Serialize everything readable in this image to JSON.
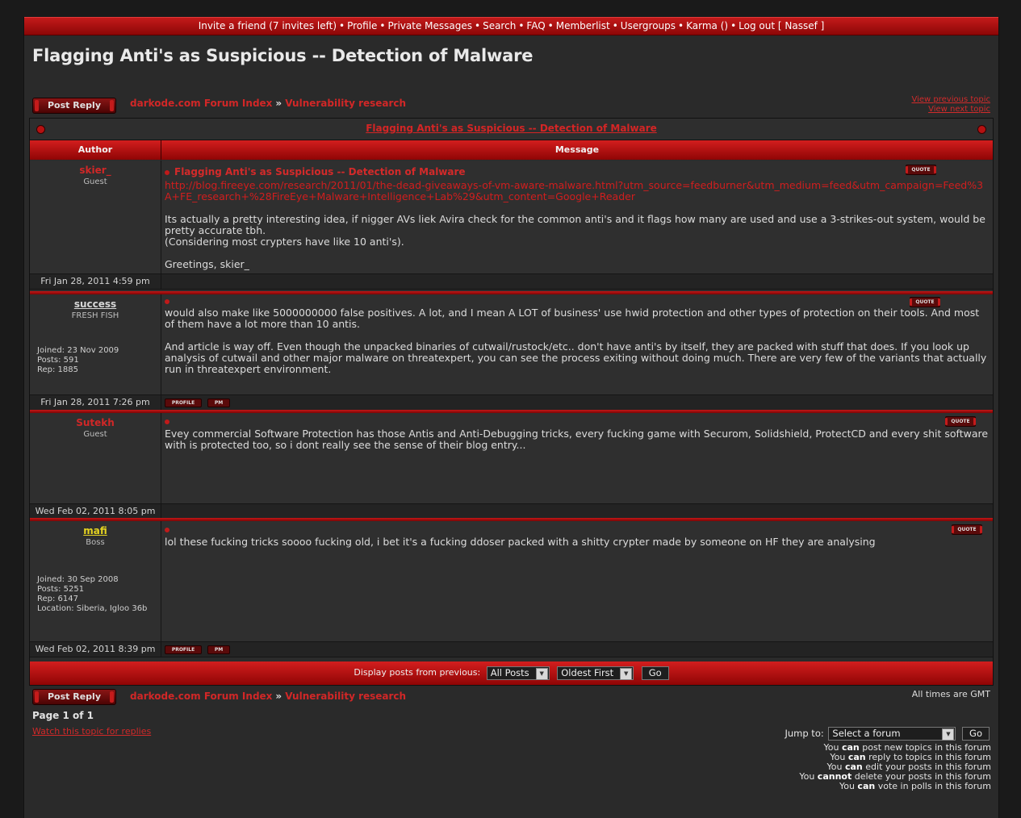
{
  "topnav": {
    "items": [
      "Invite a friend (7 invites left)",
      "Profile",
      "Private Messages",
      "Search",
      "FAQ",
      "Memberlist",
      "Usergroups",
      "Karma ()",
      "Log out [ Nassef ]"
    ],
    "separator": "•"
  },
  "page_title": "Flagging Anti's as Suspicious -- Detection of Malware",
  "post_reply_label": "Post Reply",
  "breadcrumb": {
    "home": "darkode.com Forum Index",
    "sep": "»",
    "forum": "Vulnerability research"
  },
  "prev_topic": "View previous topic",
  "next_topic": "View next topic",
  "topic_header": "Flagging Anti's as Suspicious -- Detection of Malware",
  "columns": {
    "author": "Author",
    "message": "Message"
  },
  "buttons": {
    "quote": "QUOTE",
    "profile": "PROFILE",
    "pm": "PM"
  },
  "posts": [
    {
      "author": "skier_",
      "rank": "Guest",
      "joined": "",
      "posts": "",
      "rep": "",
      "location": "",
      "subject": "Flagging Anti's as Suspicious -- Detection of Malware",
      "link": "http://blog.fireeye.com/research/2011/01/the-dead-giveaways-of-vm-aware-malware.html?utm_source=feedburner&utm_medium=feed&utm_campaign=Feed%3A+FE_research+%28FireEye+Malware+Intelligence+Lab%29&utm_content=Google+Reader",
      "para1": "Its actually a pretty interesting idea, if nigger AVs liek Avira check for the common anti's and it flags how many are used and use a 3-strikes-out system, would be pretty accurate tbh.",
      "para2": "(Considering most crypters have like 10 anti's).",
      "para3": "Greetings, skier_",
      "date": "Fri Jan 28, 2011 4:59 pm"
    },
    {
      "author": "success",
      "rank": "FRESH FISH",
      "joined": "Joined: 23 Nov 2009",
      "posts": "Posts: 591",
      "rep": "Rep: 1885",
      "para1": "would also make like 5000000000 false positives. A lot, and I mean A LOT of business' use hwid protection and other types of protection on their tools. And most of them have a lot more than 10 antis.",
      "para2": "And article is way off. Even though the unpacked binaries of cutwail/rustock/etc.. don't have anti's by itself, they are packed with stuff that does. If you look up analysis of cutwail and other major malware on threatexpert, you can see the process exiting without doing much. There are very few of the variants that actually run in threatexpert environment.",
      "date": "Fri Jan 28, 2011 7:26 pm"
    },
    {
      "author": "Sutekh",
      "rank": "Guest",
      "para1": "Evey commercial Software Protection has those Antis and Anti-Debugging tricks, every fucking game with Securom, Solidshield, ProtectCD and every shit software with is protected too, so i dont really see the sense of their blog entry...",
      "date": "Wed Feb 02, 2011 8:05 pm"
    },
    {
      "author": "mafi",
      "rank": "Boss",
      "joined": "Joined: 30 Sep 2008",
      "posts": "Posts: 5251",
      "rep": "Rep: 6147",
      "location": "Location: Siberia, Igloo 36b",
      "para1": "lol these fucking tricks soooo fucking old, i bet it's a fucking ddoser packed with a shitty crypter made by someone on HF they are analysing",
      "date": "Wed Feb 02, 2011 8:39 pm"
    }
  ],
  "display_bar": {
    "label": "Display posts from previous:",
    "filter": "All Posts",
    "order": "Oldest First",
    "go": "Go"
  },
  "timezone": "All times are GMT",
  "page_info": "Page 1 of 1",
  "watch_topic": "Watch this topic for replies",
  "jump": {
    "label": "Jump to:",
    "value": "Select a forum",
    "go": "Go"
  },
  "permissions": [
    {
      "a": "You ",
      "b": "can",
      "c": " post new topics in this forum"
    },
    {
      "a": "You ",
      "b": "can",
      "c": " reply to topics in this forum"
    },
    {
      "a": "You ",
      "b": "can",
      "c": " edit your posts in this forum"
    },
    {
      "a": "You ",
      "b": "cannot",
      "c": " delete your posts in this forum"
    },
    {
      "a": "You ",
      "b": "can",
      "c": " vote in polls in this forum"
    }
  ],
  "colors": {
    "accent": "#c41b1b",
    "bg": "#2a2a2a"
  }
}
